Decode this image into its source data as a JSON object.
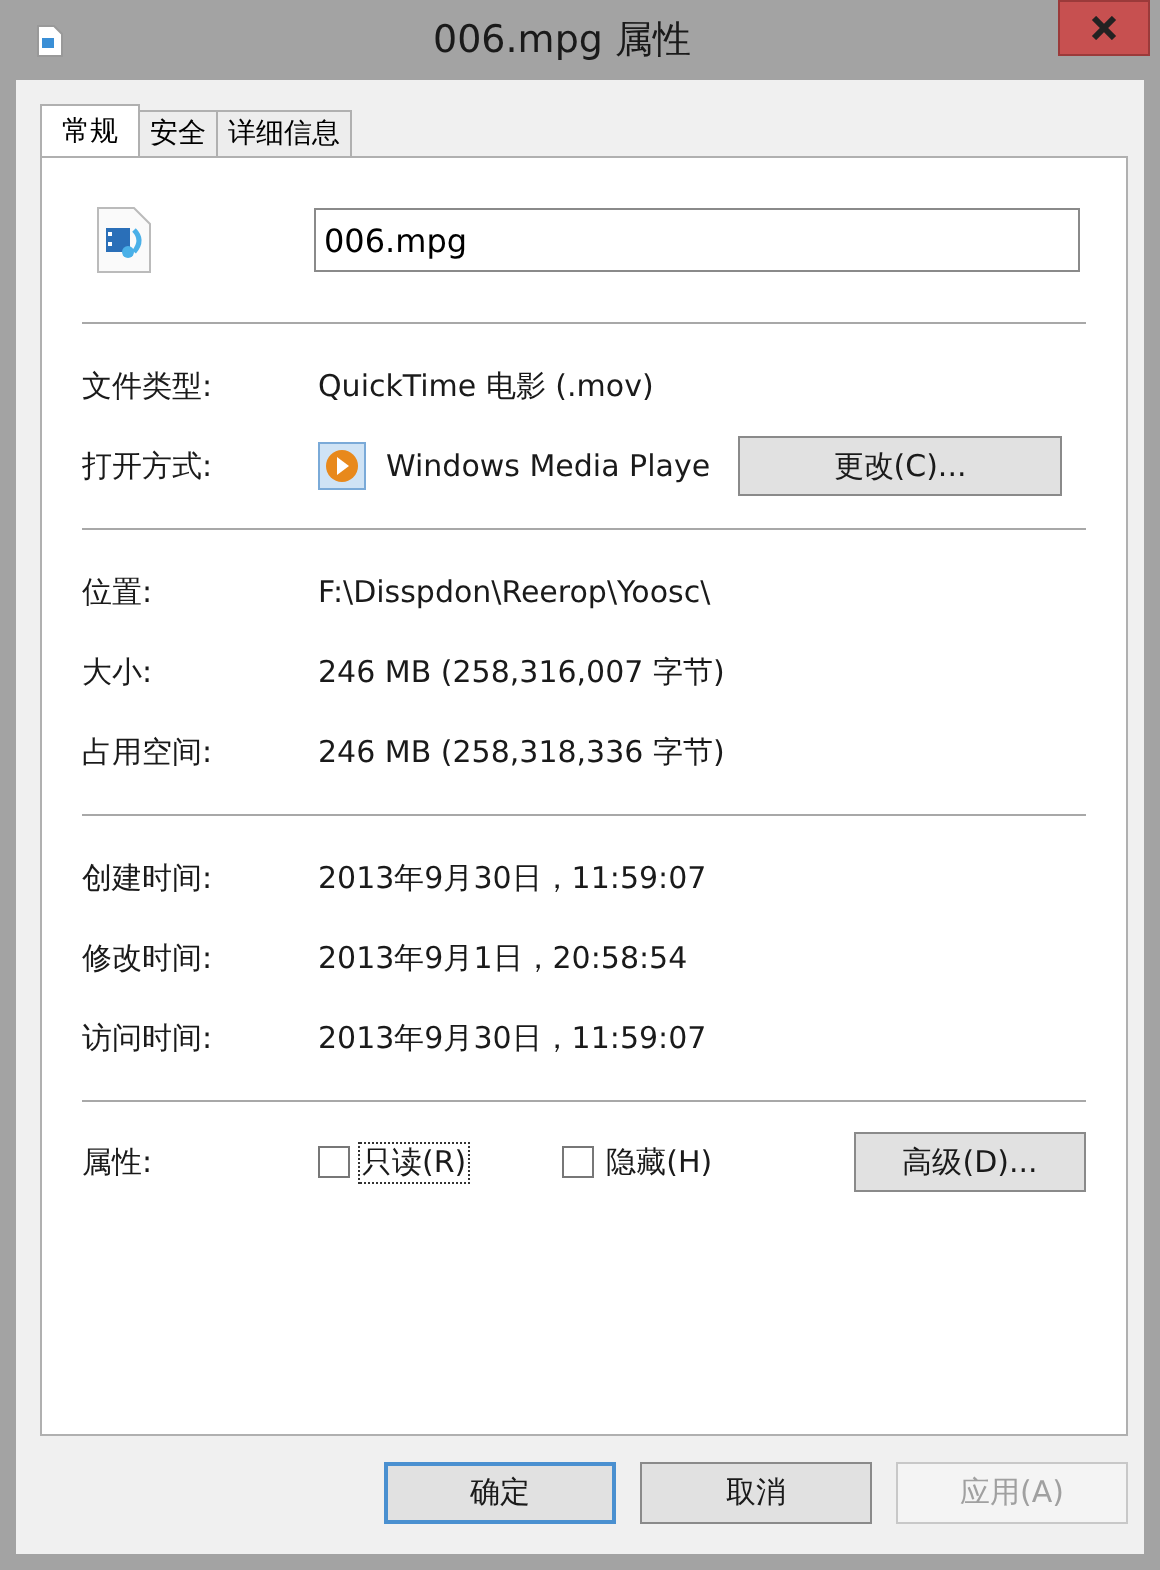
{
  "window": {
    "title": "006.mpg 属性"
  },
  "tabs": [
    {
      "label": "常规",
      "selected": true
    },
    {
      "label": "安全",
      "selected": false
    },
    {
      "label": "详细信息",
      "selected": false
    }
  ],
  "file_name": {
    "value": "006.mpg"
  },
  "sections": [
    [
      {
        "kind": "text",
        "label": "文件类型:",
        "value": "QuickTime 电影 (.mov)"
      },
      {
        "kind": "app",
        "label": "打开方式:",
        "value": "Windows Media Playe",
        "button": "更改(C)..."
      }
    ],
    [
      {
        "kind": "text",
        "label": "位置:",
        "value": "F:\\Disspdon\\Reerop\\Yoosc\\"
      },
      {
        "kind": "text",
        "label": "大小:",
        "value": "246 MB (258,316,007 字节)"
      },
      {
        "kind": "text",
        "label": "占用空间:",
        "value": "246 MB (258,318,336 字节)"
      }
    ],
    [
      {
        "kind": "text",
        "label": "创建时间:",
        "value": "2013年9月30日，11:59:07"
      },
      {
        "kind": "text",
        "label": "修改时间:",
        "value": "2013年9月1日，20:58:54"
      },
      {
        "kind": "text",
        "label": "访问时间:",
        "value": "2013年9月30日，11:59:07"
      }
    ]
  ],
  "attributes": {
    "label": "属性:",
    "options": [
      {
        "label": "只读(R)",
        "checked": false,
        "focused": true
      },
      {
        "label": "隐藏(H)",
        "checked": false,
        "focused": false
      }
    ],
    "button": "高级(D)..."
  },
  "buttons": [
    {
      "label": "确定",
      "default": true,
      "disabled": false
    },
    {
      "label": "取消",
      "default": false,
      "disabled": false
    },
    {
      "label": "应用(A)",
      "default": false,
      "disabled": true
    }
  ]
}
